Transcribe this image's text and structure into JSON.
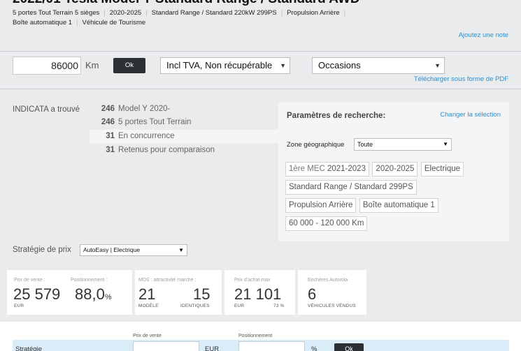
{
  "header": {
    "title": "2022/01 Tesla Model Y Standard Range / Standard AWD",
    "specs_line1": [
      "5 portes Tout Terrain 5 sièges",
      "2020-2025",
      "Standard Range / Standard 220kW 299PS",
      "Propulsion Arrière"
    ],
    "specs_line2": [
      "Boîte automatique 1",
      "Véhicule de Tourisme"
    ],
    "add_note": "Ajoutez une note"
  },
  "controls": {
    "km_value": "86000",
    "km_unit": "Km",
    "ok_label": "Ok",
    "tva_select": "Incl TVA, Non récupérable",
    "market_select": "Occasions",
    "pdf_link": "Télécharger sous forme de PDF"
  },
  "found": {
    "label": "INDICATA a trouvé",
    "rows": [
      {
        "count": "246",
        "label": "Model Y 2020-"
      },
      {
        "count": "246",
        "label": "5 portes Tout Terrain"
      },
      {
        "count": "31",
        "label": "En concurrence"
      },
      {
        "count": "31",
        "label": "Retenus pour comparaison"
      }
    ]
  },
  "search_panel": {
    "title": "Paramètres de recherche:",
    "change_link": "Changer la sélection",
    "zone_label": "Zone géographique",
    "zone_value": "Toute",
    "chips": [
      {
        "prefix": "1ère MEC ",
        "value": "2021-2023"
      },
      {
        "prefix": "",
        "value": "2020-2025"
      },
      {
        "prefix": "",
        "value": "Electrique"
      },
      {
        "prefix": "",
        "value": "Standard Range / Standard 299PS"
      },
      {
        "prefix": "",
        "value": "Propulsion Arrière"
      },
      {
        "prefix": "",
        "value": "Boîte automatique 1"
      },
      {
        "prefix": "",
        "value": "60 000 - 120 000 Km"
      }
    ]
  },
  "strategy": {
    "label": "Stratégie de prix",
    "value": "AutoEasy | Electrique"
  },
  "cards": {
    "price": {
      "label_sale": "Prix de vente :",
      "label_pos": "Positionnement :",
      "value_sale": "25 579",
      "value_pos": "88,0",
      "pos_suffix": "%",
      "unit": "EUR"
    },
    "mds": {
      "label": "MDS : attractivité marché :",
      "value_model": "21",
      "value_ident": "15",
      "unit_model": "MODÈLE",
      "unit_ident": "IDENTIQUES"
    },
    "purchase": {
      "label": "Prix d'achat max",
      "value": "21 101",
      "unit": "EUR",
      "pct": "73 %"
    },
    "auctions": {
      "label": "Enchères Autorola",
      "value": "6",
      "unit": "VÉHICULES VENDUS"
    }
  },
  "bottom": {
    "label_sale": "Prix de vente",
    "label_pos": "Positionnement",
    "row_text": "Stratégie",
    "unit_eur": "EUR",
    "unit_pct": "%",
    "ok_label": "Ok"
  },
  "colors": {
    "link": "#2b8fd3",
    "button": "#2d3033",
    "background": "#e9ebed"
  }
}
